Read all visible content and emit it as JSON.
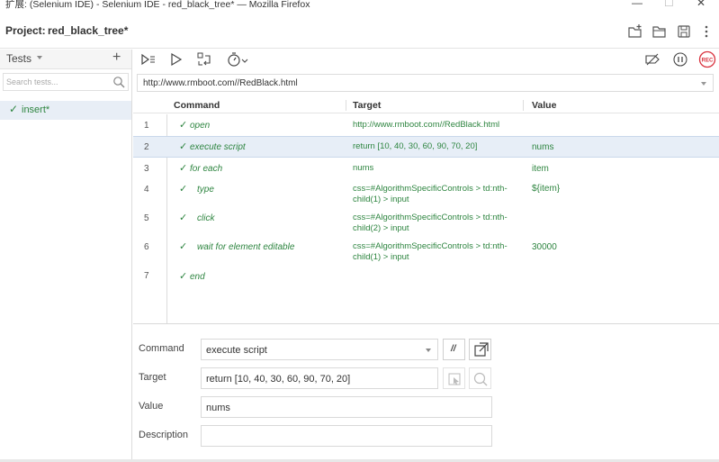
{
  "window": {
    "title": "扩展: (Selenium IDE) - Selenium IDE - red_black_tree* — Mozilla Firefox",
    "min_glyph": "—",
    "max_glyph": "☐",
    "close_glyph": "✕"
  },
  "project": {
    "label": "Project:",
    "name": "red_black_tree*"
  },
  "tests_panel": {
    "header": "Tests",
    "add_glyph": "+",
    "search_placeholder": "Search tests...",
    "items": [
      {
        "check": "✓",
        "name": "insert*"
      }
    ]
  },
  "base_url": "http://www.rmboot.com//RedBlack.html",
  "table": {
    "headers": {
      "command": "Command",
      "target": "Target",
      "value": "Value"
    },
    "rows": [
      {
        "num": "1",
        "check": "✓",
        "command": "open",
        "target": "http://www.rmboot.com//RedBlack.html",
        "value": ""
      },
      {
        "num": "2",
        "check": "✓",
        "command": "execute script",
        "target": "return [10, 40, 30, 60, 90, 70, 20]",
        "value": "nums"
      },
      {
        "num": "3",
        "check": "✓",
        "command": "for each",
        "target": "nums",
        "value": "item"
      },
      {
        "num": "4",
        "check": "✓",
        "command": "type",
        "target": "css=#AlgorithmSpecificControls > td:nth-child(1) > input",
        "value": "${item}"
      },
      {
        "num": "5",
        "check": "✓",
        "command": "click",
        "target": "css=#AlgorithmSpecificControls > td:nth-child(2) > input",
        "value": ""
      },
      {
        "num": "6",
        "check": "✓",
        "command": "wait for element editable",
        "target": "css=#AlgorithmSpecificControls > td:nth-child(1) > input",
        "value": "30000"
      },
      {
        "num": "7",
        "check": "✓",
        "command": "end",
        "target": "",
        "value": ""
      }
    ]
  },
  "editor": {
    "command_label": "Command",
    "command_value": "execute script",
    "comment_glyph": "//",
    "target_label": "Target",
    "target_value": "return [10, 40, 30, 60, 90, 70, 20]",
    "value_label": "Value",
    "value_value": "nums",
    "description_label": "Description",
    "description_value": ""
  },
  "toolbar": {
    "record_label": "REC"
  },
  "colors": {
    "success_green": "#2e8540",
    "selected_row": "#e7eef7",
    "record_red": "#d9333f"
  }
}
